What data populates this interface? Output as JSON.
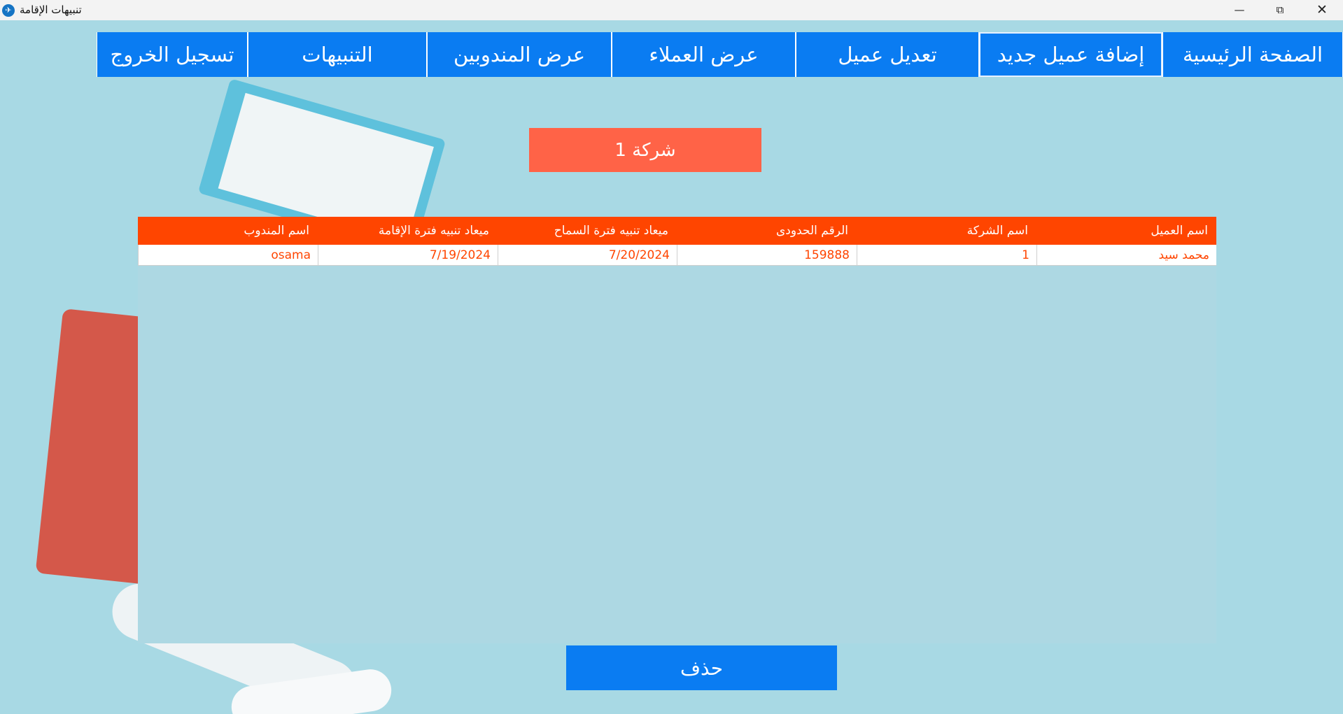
{
  "window": {
    "title": "تنبيهات الإقامة",
    "min_icon": "minimize-icon",
    "max_icon": "restore-icon",
    "close_icon": "close-icon"
  },
  "nav": [
    {
      "label": "تسجيل الخروج"
    },
    {
      "label": "التنبيهات"
    },
    {
      "label": "عرض المندوبين"
    },
    {
      "label": "عرض العملاء"
    },
    {
      "label": "تعديل عميل"
    },
    {
      "label": "إضافة عميل جديد"
    },
    {
      "label": "الصفحة الرئيسية"
    }
  ],
  "company": {
    "label": "شركة 1"
  },
  "table": {
    "headers": [
      "اسم العميل",
      "اسم الشركة",
      "الرقم الحدودى",
      "ميعاد تنبيه فترة السماح",
      "ميعاد تنبيه فترة الإقامة",
      "اسم المندوب"
    ],
    "rows": [
      [
        "محمد سيد",
        "1",
        "159888",
        "7/20/2024",
        "7/19/2024",
        "osama"
      ]
    ]
  },
  "actions": {
    "delete_label": "حذف"
  },
  "colors": {
    "nav_blue": "#0a7cf2",
    "header_orange": "#ff4500",
    "company_button": "#ff6347",
    "background": "#a8d9e4"
  }
}
